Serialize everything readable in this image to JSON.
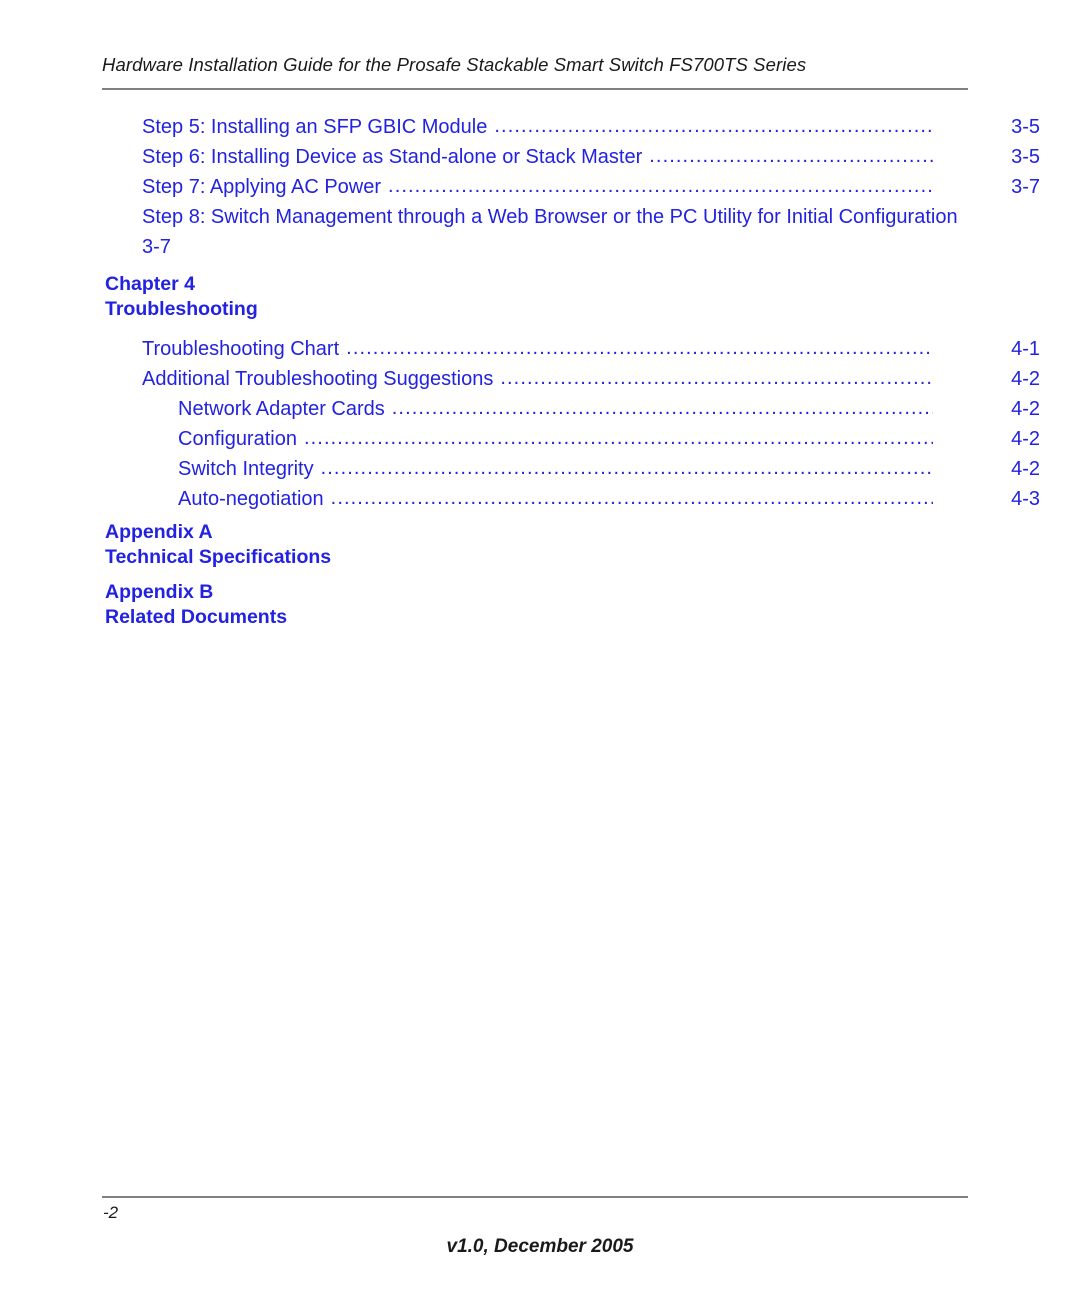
{
  "header": {
    "title": "Hardware Installation Guide for the Prosafe Stackable Smart Switch FS700TS Series"
  },
  "toc": {
    "entries": [
      {
        "level": 1,
        "label": "Step 5: Installing an SFP GBIC Module",
        "page": "3-5",
        "leader": true
      },
      {
        "level": 1,
        "label": "Step 6: Installing Device as Stand-alone or Stack Master",
        "page": "3-5",
        "leader": true
      },
      {
        "level": 1,
        "label": "Step 7: Applying AC Power",
        "page": "3-7",
        "leader": true
      },
      {
        "level": 1,
        "label": "Step 8: Switch Management through a Web Browser or the PC Utility for Initial Configuration",
        "page": "3-7",
        "leader": false
      },
      {
        "level": 1,
        "label": "Troubleshooting Chart",
        "page": "4-1",
        "leader": true
      },
      {
        "level": 1,
        "label": "Additional Troubleshooting Suggestions",
        "page": "4-2",
        "leader": true
      },
      {
        "level": 2,
        "label": "Network Adapter Cards",
        "page": "4-2",
        "leader": true
      },
      {
        "level": 2,
        "label": "Configuration",
        "page": "4-2",
        "leader": true
      },
      {
        "level": 2,
        "label": "Switch Integrity",
        "page": "4-2",
        "leader": true
      },
      {
        "level": 2,
        "label": "Auto-negotiation",
        "page": "4-3",
        "leader": true
      }
    ],
    "leader_dots": "............................................................................................................................................................................"
  },
  "headings": {
    "chapter4": {
      "line1": "Chapter 4",
      "line2": "Troubleshooting"
    },
    "appendixA": {
      "line1": "Appendix A",
      "line2": "Technical Specifications"
    },
    "appendixB": {
      "line1": "Appendix B",
      "line2": "Related Documents"
    }
  },
  "footer": {
    "page_number": "-2",
    "version": "v1.0, December 2005"
  },
  "colors": {
    "link_blue": "#2222e0",
    "rule_gray": "#808080",
    "body_black": "#1a1a1a"
  }
}
